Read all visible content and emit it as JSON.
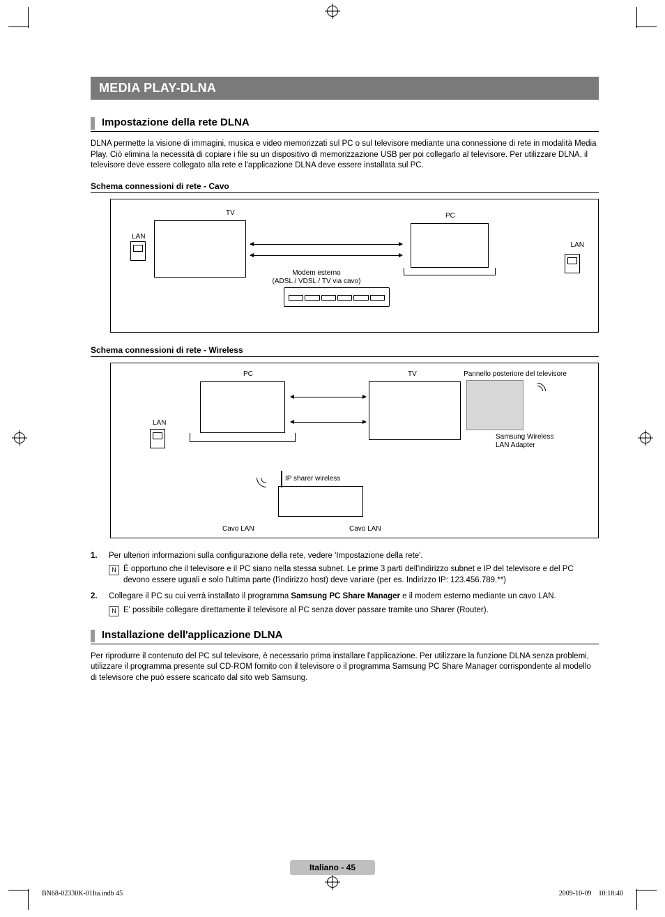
{
  "banner": "MEDIA PLAY-DLNA",
  "section1": {
    "title": "Impostazione della rete DLNA",
    "body": "DLNA permette la visione di immagini, musica e video memorizzati sul PC o sul televisore mediante una connessione di rete in modalità Media Play. Ciò elimina la necessità di copiare i file su un dispositivo di memorizzazione USB per poi collegarlo al televisore. Per utilizzare DLNA, il televisore deve essere collegato alla rete e l'applicazione DLNA deve essere installata sul PC."
  },
  "diagram_cable": {
    "title": "Schema connessioni di rete - Cavo",
    "labels": {
      "tv": "TV",
      "pc": "PC",
      "lan_left": "LAN",
      "lan_right": "LAN",
      "modem_line1": "Modem esterno",
      "modem_line2": "(ADSL / VDSL / TV via cavo)"
    }
  },
  "diagram_wireless": {
    "title": "Schema connessioni di rete - Wireless",
    "labels": {
      "pc": "PC",
      "tv": "TV",
      "back_panel": "Pannello posteriore del televisore",
      "lan": "LAN",
      "adapter_line1": "Samsung Wireless",
      "adapter_line2": "LAN Adapter",
      "router": "IP sharer wireless",
      "cable_l": "Cavo LAN",
      "cable_r": "Cavo LAN"
    }
  },
  "list": {
    "item1_num": "1.",
    "item1_text": "Per ulteriori informazioni sulla configurazione della rete, vedere 'Impostazione della rete'.",
    "item1_note": "È opportuno che il televisore e il PC siano nella stessa subnet. Le prime 3 parti dell'indirizzo subnet e IP del televisore e del PC devono essere uguali e solo l'ultima parte (l'indirizzo host) deve variare (per es. Indirizzo IP: 123.456.789.**)",
    "item2_num": "2.",
    "item2_text_a": "Collegare il PC su cui verrà installato il programma ",
    "item2_text_bold": "Samsung PC Share Manager",
    "item2_text_b": " e il modem esterno mediante un cavo LAN.",
    "item2_note": "E' possibile collegare direttamente il televisore al PC senza dover passare tramite uno Sharer (Router)."
  },
  "section2": {
    "title": "Installazione dell'applicazione DLNA",
    "body": "Per riprodurre il contenuto del PC sul televisore, è necessario prima installare l'applicazione. Per utilizzare la funzione DLNA senza problemi, utilizzare il programma presente sul CD-ROM fornito con il televisore o il programma Samsung PC Share Manager corrispondente al modello di televisore che può essere scaricato dal sito web Samsung."
  },
  "footer": {
    "page_label": "Italiano - 45",
    "indb": "BN68-02330K-01Ita.indb   45",
    "timestamp": "2009-10-09      10:18:40"
  },
  "note_glyph": "N"
}
